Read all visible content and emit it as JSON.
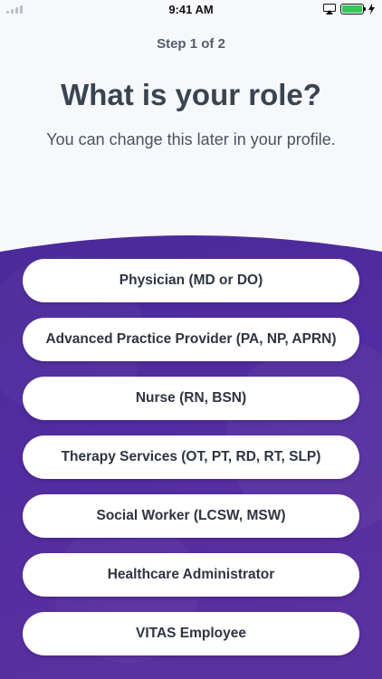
{
  "status_bar": {
    "time": "9:41 AM"
  },
  "header": {
    "step": "Step 1 of 2",
    "title": "What is your role?",
    "subtitle": "You can change this later in your profile."
  },
  "roles": [
    "Physician (MD or DO)",
    "Advanced Practice Provider (PA, NP, APRN)",
    "Nurse (RN, BSN)",
    "Therapy Services (OT, PT, RD, RT, SLP)",
    "Social Worker (LCSW, MSW)",
    "Healthcare Administrator",
    "VITAS Employee"
  ],
  "colors": {
    "panel_top": "#4b2a9a",
    "panel_bottom": "#5a2f9e",
    "battery": "#35c759",
    "background": "#f7f8fb"
  }
}
